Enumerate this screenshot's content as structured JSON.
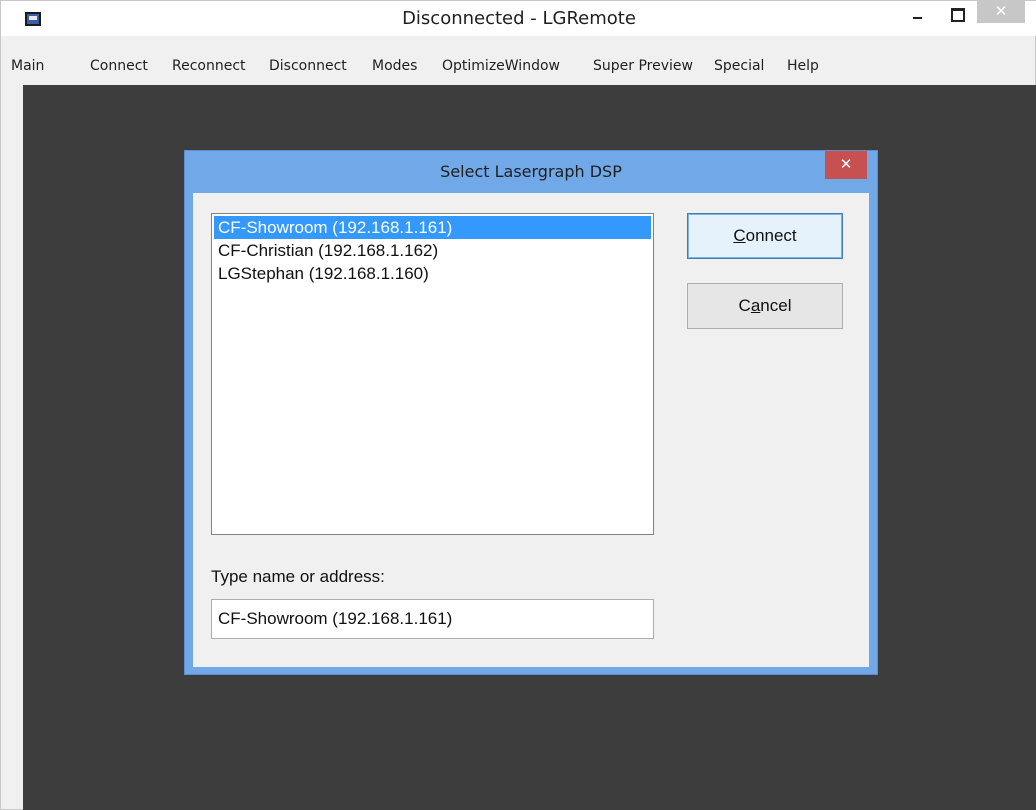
{
  "window": {
    "title": "Disconnected - LGRemote",
    "close_glyph": "✕",
    "icons": [
      "app-icon",
      "minimize-icon",
      "maximize-icon",
      "close-icon"
    ]
  },
  "menu": [
    "Main",
    "Connect",
    "Reconnect",
    "Disconnect",
    "Modes",
    "OptimizeWindow",
    "Super Preview",
    "Special",
    "Help"
  ],
  "dialog": {
    "title": "Select Lasergraph DSP",
    "close_glyph": "✕",
    "devices": [
      "CF-Showroom (192.168.1.161)",
      "CF-Christian (192.168.1.162)",
      "LGStephan (192.168.1.160)"
    ],
    "selected_index": 0,
    "connect_button": {
      "accel": "C",
      "rest": "onnect"
    },
    "cancel_button": {
      "pre": "C",
      "accel": "a",
      "rest": "ncel"
    },
    "address_label": "Type name or address:",
    "address_value": "CF-Showroom (192.168.1.161)"
  },
  "colors": {
    "dialog_frame": "#71a8e8",
    "selection": "#3399ff",
    "client_background": "#3d3d3d",
    "close_button": "#c75050"
  }
}
